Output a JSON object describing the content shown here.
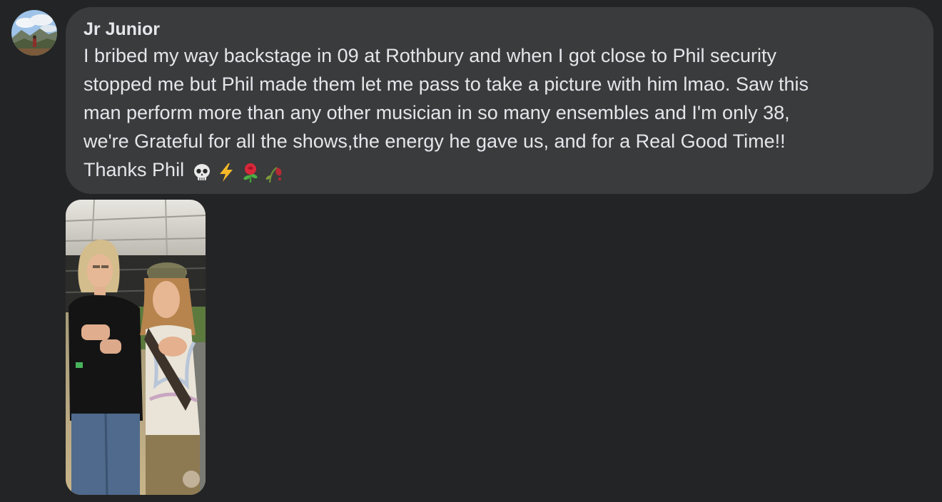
{
  "comment": {
    "author": "Jr Junior",
    "lines": [
      "I bribed my way backstage in 09 at Rothbury and when I got close to Phil security",
      "stopped me but Phil made them let me pass to take a picture with him lmao. Saw this",
      "man perform more than any other musician in so many ensembles and I'm only 38,",
      "we're Grateful for all the shows,the energy he gave us, and for a Real Good Time!!",
      "Thanks Phil"
    ],
    "emojis": [
      "skull-emoji",
      "lightning-emoji",
      "rose-emoji",
      "wilted-rose-emoji"
    ]
  },
  "theme": {
    "background": "#232425",
    "bubble": "#3a3b3c",
    "text": "#e4e6eb"
  }
}
